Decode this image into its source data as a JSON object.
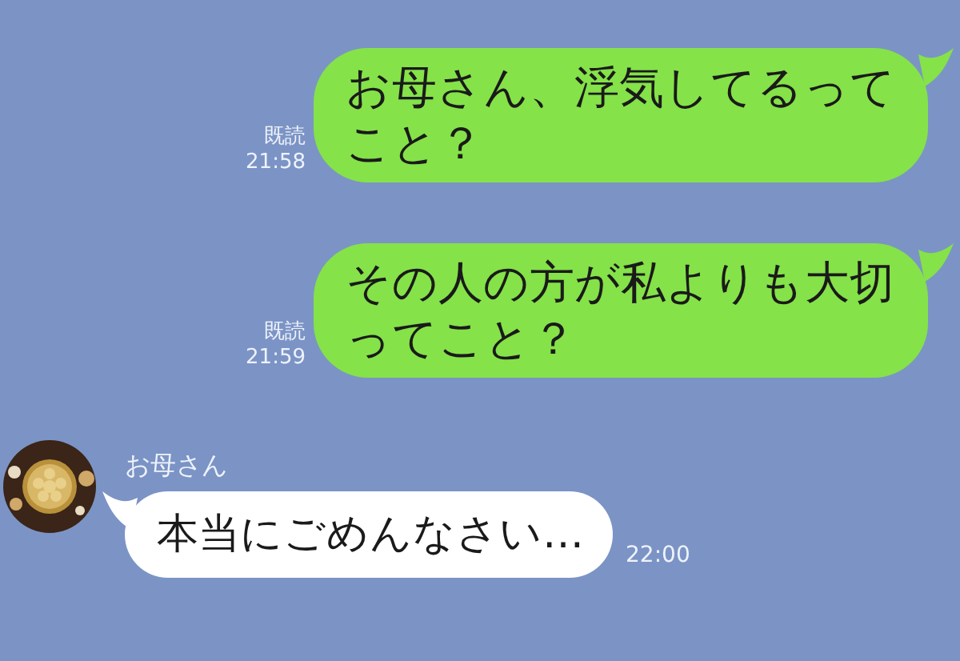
{
  "messages": [
    {
      "kind": "sent",
      "text": "お母さん、浮気してるってこと？",
      "read_label": "既読",
      "time": "21:58"
    },
    {
      "kind": "sent",
      "text": "その人の方が私よりも大切ってこと？",
      "read_label": "既読",
      "time": "21:59"
    },
    {
      "kind": "received",
      "sender": "お母さん",
      "text": "本当にごめんなさい…",
      "time": "22:00"
    }
  ]
}
